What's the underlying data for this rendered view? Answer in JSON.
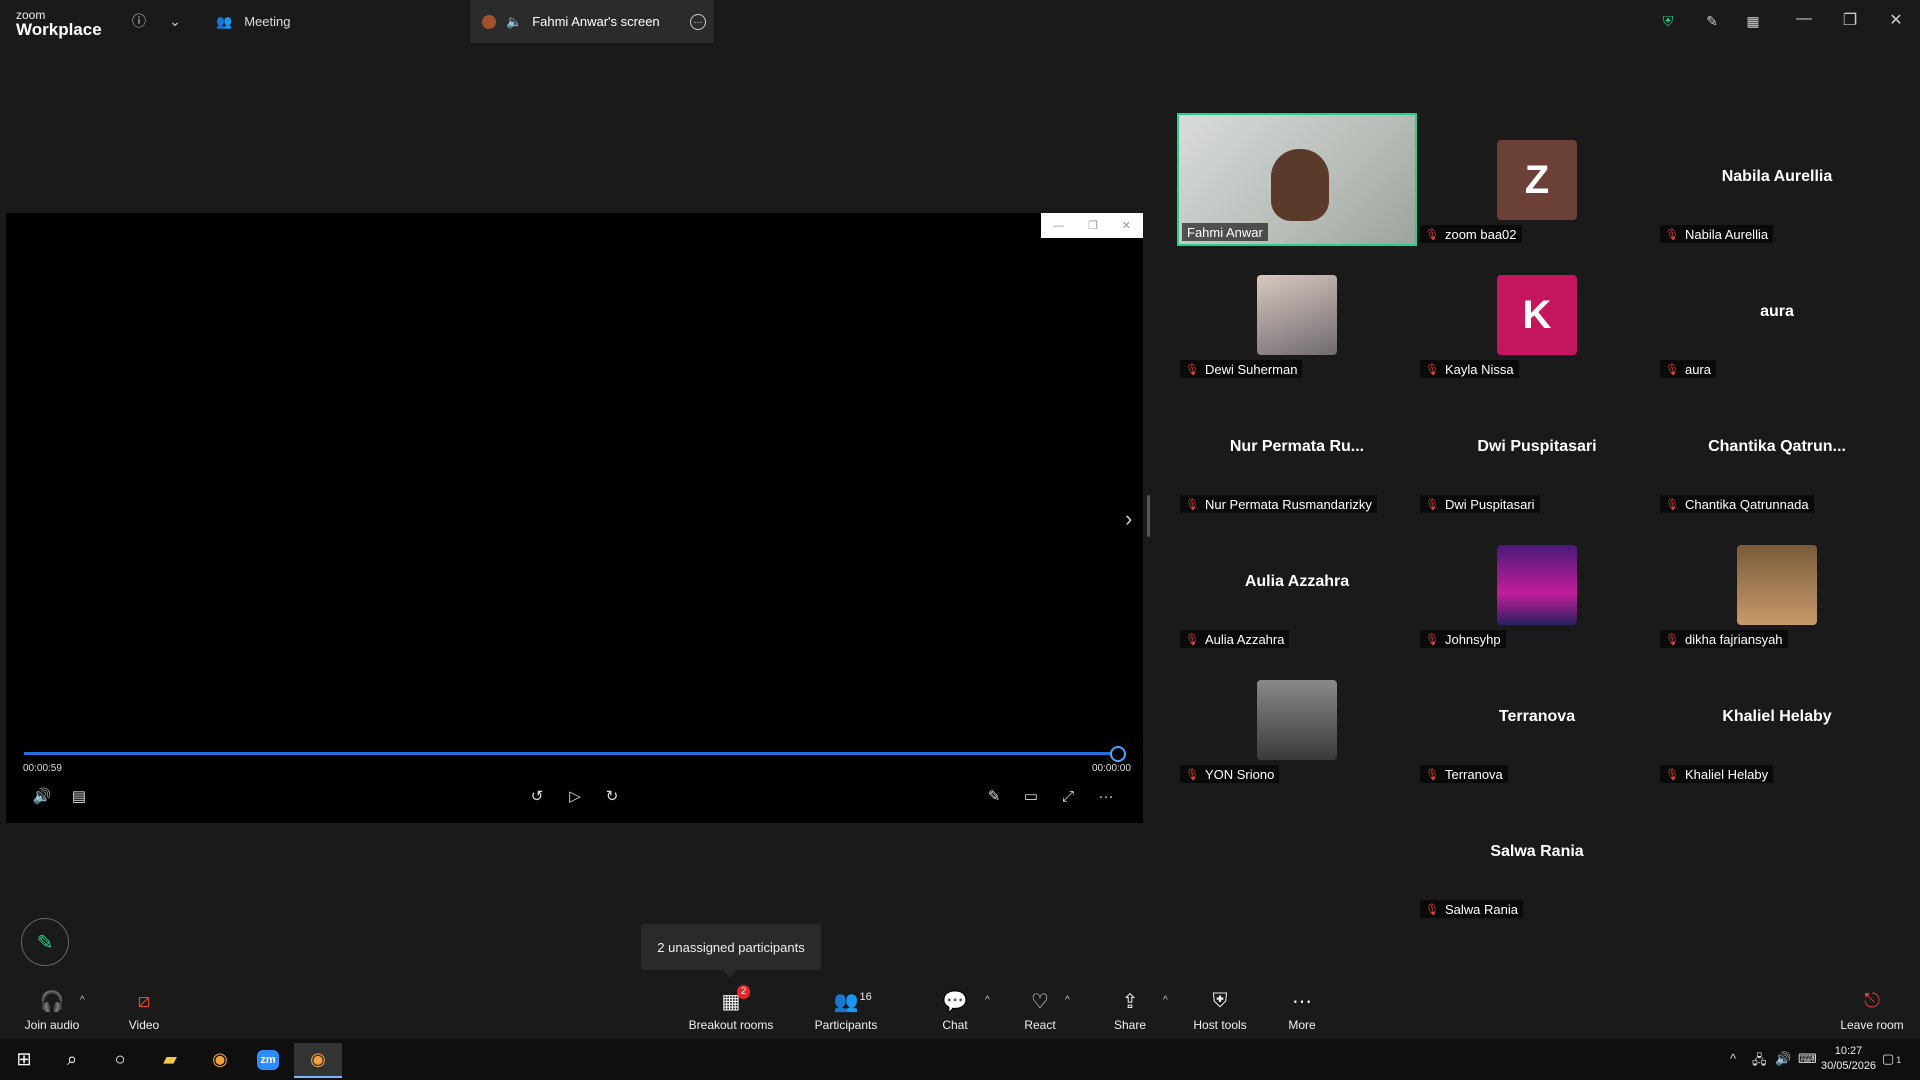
{
  "titlebar": {
    "logo_top": "zoom",
    "logo_bottom": "Workplace",
    "meeting_label": "Meeting",
    "screen_tab_label": "Fahmi Anwar's screen"
  },
  "player": {
    "elapsed": "00:00:59",
    "remaining": "00:00:00",
    "progress_fraction": 1.0
  },
  "participants": [
    {
      "name": "Fahmi Anwar",
      "kind": "video",
      "active": true
    },
    {
      "name": "zoom baa02",
      "kind": "letter",
      "letter": "Z",
      "color": "#6b4037"
    },
    {
      "name": "Nabila Aurellia",
      "kind": "name",
      "display": "Nabila Aurellia"
    },
    {
      "name": "Dewi Suherman",
      "kind": "photo"
    },
    {
      "name": "Kayla Nissa",
      "kind": "letter",
      "letter": "K",
      "color": "#c4155f"
    },
    {
      "name": "aura",
      "kind": "name",
      "display": "aura"
    },
    {
      "name": "Nur Permata Rusmandarizky",
      "kind": "name",
      "display": "Nur Permata Ru..."
    },
    {
      "name": "Dwi Puspitasari",
      "kind": "name",
      "display": "Dwi Puspitasari"
    },
    {
      "name": "Chantika Qatrunnada",
      "kind": "name",
      "display": "Chantika  Qatrun..."
    },
    {
      "name": "Aulia Azzahra",
      "kind": "name",
      "display": "Aulia Azzahra"
    },
    {
      "name": "Johnsyhp",
      "kind": "photo"
    },
    {
      "name": "dikha fajriansyah",
      "kind": "photo"
    },
    {
      "name": "YON Sriono",
      "kind": "photo"
    },
    {
      "name": "Terranova",
      "kind": "name",
      "display": "Terranova"
    },
    {
      "name": "Khaliel Helaby",
      "kind": "name",
      "display": "Khaliel Helaby"
    },
    {
      "name": "Salwa Rania",
      "kind": "name",
      "display": "Salwa Rania"
    }
  ],
  "tooltip": "2 unassigned participants",
  "toolbar": {
    "join_audio": "Join audio",
    "video": "Video",
    "breakout_rooms": "Breakout rooms",
    "breakout_badge": "2",
    "participants": "Participants",
    "participants_count": "16",
    "chat": "Chat",
    "react": "React",
    "share": "Share",
    "host_tools": "Host tools",
    "more": "More",
    "leave_room": "Leave room"
  },
  "taskbar": {
    "time": "10:27",
    "date": "30/05/2026",
    "notification_count": "1"
  },
  "colors": {
    "active_border": "#23d18b",
    "muted_red": "#e8433b",
    "progress_blue": "#1e6fd9"
  }
}
